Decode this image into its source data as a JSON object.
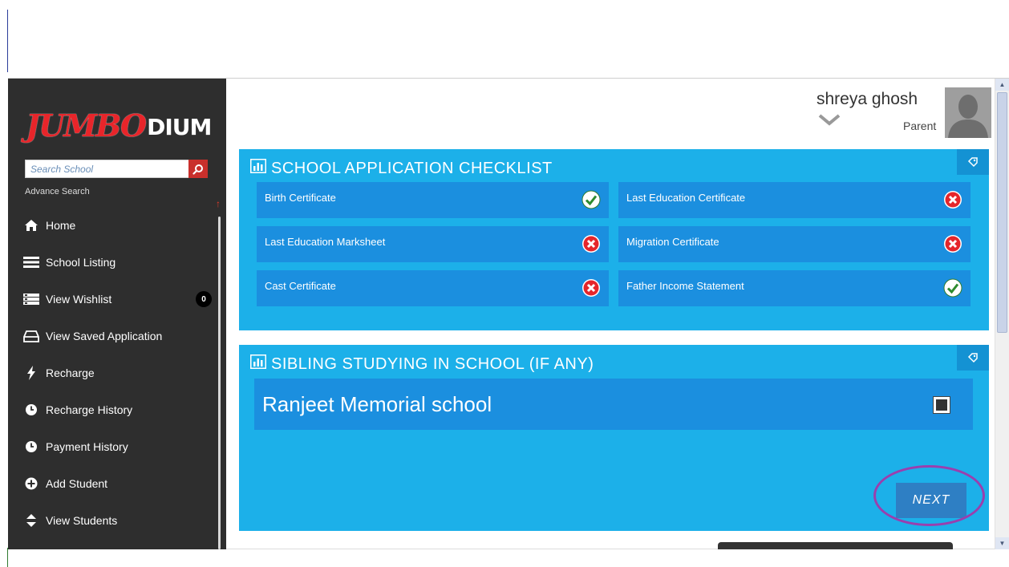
{
  "brand": {
    "logo_part1": "JUMBO",
    "logo_part2": "DIUM"
  },
  "search": {
    "placeholder": "Search School",
    "advance_label": "Advance Search"
  },
  "nav": {
    "items": [
      {
        "label": "Home",
        "icon": "home-icon"
      },
      {
        "label": "School Listing",
        "icon": "list-icon"
      },
      {
        "label": "View Wishlist",
        "icon": "wishlist-icon",
        "badge": "0"
      },
      {
        "label": "View Saved Application",
        "icon": "drive-icon"
      },
      {
        "label": "Recharge",
        "icon": "bolt-icon"
      },
      {
        "label": "Recharge History",
        "icon": "clock-icon"
      },
      {
        "label": "Payment History",
        "icon": "clock-icon"
      },
      {
        "label": "Add Student",
        "icon": "plus-circle-icon"
      },
      {
        "label": "View Students",
        "icon": "sort-icon"
      }
    ]
  },
  "user": {
    "name": "shreya ghosh",
    "role": "Parent"
  },
  "checklist": {
    "title": "SCHOOL APPLICATION CHECKLIST",
    "items": [
      {
        "label": "Birth Certificate",
        "status": "yes"
      },
      {
        "label": "Last Education Certificate",
        "status": "no"
      },
      {
        "label": "Last Education Marksheet",
        "status": "no"
      },
      {
        "label": "Migration Certificate",
        "status": "no"
      },
      {
        "label": "Cast Certificate",
        "status": "no"
      },
      {
        "label": "Father Income Statement",
        "status": "yes"
      }
    ]
  },
  "sibling": {
    "title": "SIBLING STUDYING IN SCHOOL (IF ANY)",
    "school": "Ranjeet Memorial school",
    "checked": true
  },
  "actions": {
    "next_label": "NEXT"
  },
  "colors": {
    "panel": "#1cb0e9",
    "row": "#1b8fdf",
    "sidebar": "#2e2e2e",
    "accent_red": "#e8252a",
    "highlight_ring": "#9a3fae"
  }
}
